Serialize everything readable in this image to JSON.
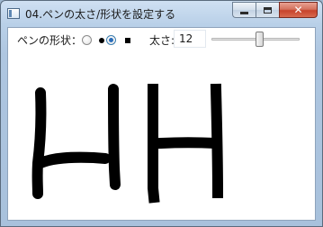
{
  "window": {
    "title": "04.ペンの太さ/形状を設定する",
    "icon": "window-app-icon",
    "buttons": {
      "minimize_icon": "minimize-icon",
      "maximize_icon": "maximize-icon",
      "close_icon": "close-icon",
      "close_glyph": "✕"
    }
  },
  "toolbar": {
    "pen_shape_label": "ペンの形状：",
    "pen_shape_options": [
      {
        "shape": "round",
        "icon": "round-tip-icon",
        "selected": false
      },
      {
        "shape": "square",
        "icon": "square-tip-icon",
        "selected": true
      }
    ],
    "thickness_label": "太さ:",
    "thickness_value": "12",
    "slider_level": 0.55
  },
  "canvas": {
    "ink_color": "#000000",
    "strokes": [
      {
        "name": "stroke-left-1",
        "tip": "round"
      },
      {
        "name": "stroke-left-2",
        "tip": "round"
      },
      {
        "name": "stroke-left-3",
        "tip": "round"
      },
      {
        "name": "stroke-right-1",
        "tip": "square"
      },
      {
        "name": "stroke-right-2",
        "tip": "square"
      },
      {
        "name": "stroke-right-3",
        "tip": "square"
      }
    ]
  },
  "colors": {
    "title_bar": "#b9d0e8",
    "close_button": "#c7432b",
    "radio_accent": "#2a6ebb",
    "canvas_bg": "#ffffff"
  }
}
